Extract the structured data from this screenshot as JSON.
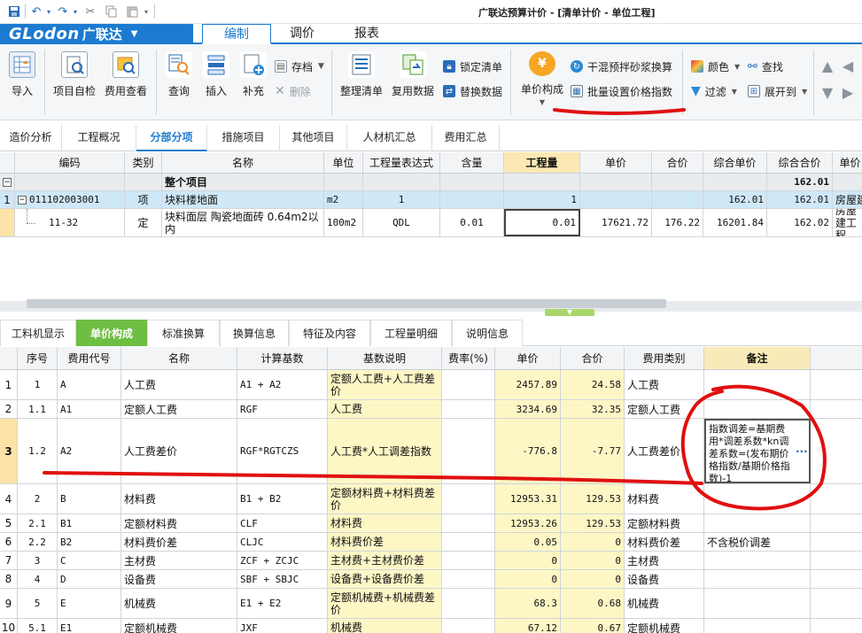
{
  "window": {
    "title": "广联达预算计价 - [清单计价 - 单位工程]"
  },
  "quick_access": {
    "icons": [
      "save-icon",
      "undo-icon",
      "redo-icon",
      "cut-icon",
      "copy-icon",
      "paste-icon",
      "dropdown-icon"
    ]
  },
  "logo": {
    "brand": "GLodon",
    "brand_cn": "广联达",
    "menu_arrow": "▼"
  },
  "menu_tabs": [
    {
      "label": "编制",
      "active": true
    },
    {
      "label": "调价",
      "active": false
    },
    {
      "label": "报表",
      "active": false
    }
  ],
  "ribbon": {
    "import": "导入",
    "self_check": "项目自检",
    "fee_check": "费用查看",
    "query": "查询",
    "insert": "插入",
    "supplement": "补充",
    "save": "存档",
    "delete": "删除",
    "organize": "整理清单",
    "reuse": "复用数据",
    "lock": "锁定清单",
    "replace": "替换数据",
    "price_build": "单价构成",
    "mortar": "干混预拌砂浆换算",
    "batch_index": "批量设置价格指数",
    "color": "颜色",
    "filter": "过滤",
    "find": "查找",
    "expand": "展开到",
    "icons": {
      "import": "import-icon",
      "self_check": "self-check-icon",
      "fee_check": "fee-check-icon",
      "query": "query-icon",
      "insert": "insert-icon",
      "supplement": "supplement-icon",
      "organize": "organize-icon",
      "reuse": "reuse-icon",
      "price_build": "price-build-icon"
    }
  },
  "nav_tabs": [
    "造价分析",
    "工程概况",
    "分部分项",
    "措施项目",
    "其他项目",
    "人材机汇总",
    "费用汇总"
  ],
  "nav_active": "分部分项",
  "grid1": {
    "headers": [
      "编码",
      "类别",
      "名称",
      "单位",
      "工程量表达式",
      "含量",
      "工程量",
      "单价",
      "合价",
      "综合单价",
      "综合合价",
      "单价"
    ],
    "whole_row": {
      "name": "整个项目",
      "total": "162.01",
      "toggle": "−"
    },
    "rows": [
      {
        "idx": "1",
        "toggle": "−",
        "code": "011102003001",
        "type": "项",
        "name": "块料楼地面",
        "unit": "m2",
        "expr": "1",
        "qty": "1",
        "price": "",
        "total": "",
        "unit_price": "162.01",
        "sum_price": "162.01",
        "extra": "房屋建"
      },
      {
        "idx": "",
        "toggle": "",
        "code": "11-32",
        "type": "定",
        "name": "块料面层 陶瓷地面砖 0.64m2以内",
        "unit": "100m2",
        "expr": "QDL",
        "content": "0.01",
        "qty": "0.01",
        "price": "17621.72",
        "total": "176.22",
        "unit_price": "16201.84",
        "sum_price": "162.02",
        "extra": "房屋建工程"
      }
    ]
  },
  "sub_tabs": [
    "工料机显示",
    "单价构成",
    "标准换算",
    "换算信息",
    "特征及内容",
    "工程量明细",
    "说明信息"
  ],
  "sub_active": "单价构成",
  "grid2": {
    "headers": [
      "序号",
      "费用代号",
      "名称",
      "计算基数",
      "基数说明",
      "费率(%)",
      "单价",
      "合价",
      "费用类别",
      "备注"
    ],
    "rows": [
      {
        "n": "1",
        "seq": "1",
        "code": "A",
        "name": "人工费",
        "base": "A1 + A2",
        "desc": "定额人工费+人工费差价",
        "rate": "",
        "price": "2457.89",
        "total": "24.58",
        "cat": "人工费",
        "note": ""
      },
      {
        "n": "2",
        "seq": "1.1",
        "code": "A1",
        "name": "定额人工费",
        "base": "RGF",
        "desc": "人工费",
        "rate": "",
        "price": "3234.69",
        "total": "32.35",
        "cat": "定额人工费",
        "note": ""
      },
      {
        "n": "3",
        "seq": "1.2",
        "code": "A2",
        "name": "人工费差价",
        "base": "RGF*RGTCZS",
        "desc": "人工费*人工调差指数",
        "rate": "",
        "price": "-776.8",
        "total": "-7.77",
        "cat": "人工费差价",
        "note": "指数调差=基期费用*调差系数*kn调差系数=(发布期价格指数/基期价格指数)-1"
      },
      {
        "n": "4",
        "seq": "2",
        "code": "B",
        "name": "材料费",
        "base": "B1 + B2",
        "desc": "定额材料费+材料费差价",
        "rate": "",
        "price": "12953.31",
        "total": "129.53",
        "cat": "材料费",
        "note": ""
      },
      {
        "n": "5",
        "seq": "2.1",
        "code": "B1",
        "name": "定额材料费",
        "base": "CLF",
        "desc": "材料费",
        "rate": "",
        "price": "12953.26",
        "total": "129.53",
        "cat": "定额材料费",
        "note": ""
      },
      {
        "n": "6",
        "seq": "2.2",
        "code": "B2",
        "name": "材料费价差",
        "base": "CLJC",
        "desc": "材料费价差",
        "rate": "",
        "price": "0.05",
        "total": "0",
        "cat": "材料费价差",
        "note": "不含税价调差"
      },
      {
        "n": "7",
        "seq": "3",
        "code": "C",
        "name": "主材费",
        "base": "ZCF + ZCJC",
        "desc": "主材费+主材费价差",
        "rate": "",
        "price": "0",
        "total": "0",
        "cat": "主材费",
        "note": ""
      },
      {
        "n": "8",
        "seq": "4",
        "code": "D",
        "name": "设备费",
        "base": "SBF + SBJC",
        "desc": "设备费+设备费价差",
        "rate": "",
        "price": "0",
        "total": "0",
        "cat": "设备费",
        "note": ""
      },
      {
        "n": "9",
        "seq": "5",
        "code": "E",
        "name": "机械费",
        "base": "E1 + E2",
        "desc": "定额机械费+机械费差价",
        "rate": "",
        "price": "68.3",
        "total": "0.68",
        "cat": "机械费",
        "note": ""
      },
      {
        "n": "10",
        "seq": "5.1",
        "code": "E1",
        "name": "定额机械费",
        "base": "JXF",
        "desc": "机械费",
        "rate": "",
        "price": "67.12",
        "total": "0.67",
        "cat": "定额机械费",
        "note": ""
      }
    ],
    "ellipsis": "···"
  },
  "colors": {
    "accent": "#1c7bd0",
    "active_subtab": "#6fbe44",
    "highlight_row": "#cfe8f8",
    "yellow_col": "#fdf7c6",
    "annotation": "#e01010"
  }
}
